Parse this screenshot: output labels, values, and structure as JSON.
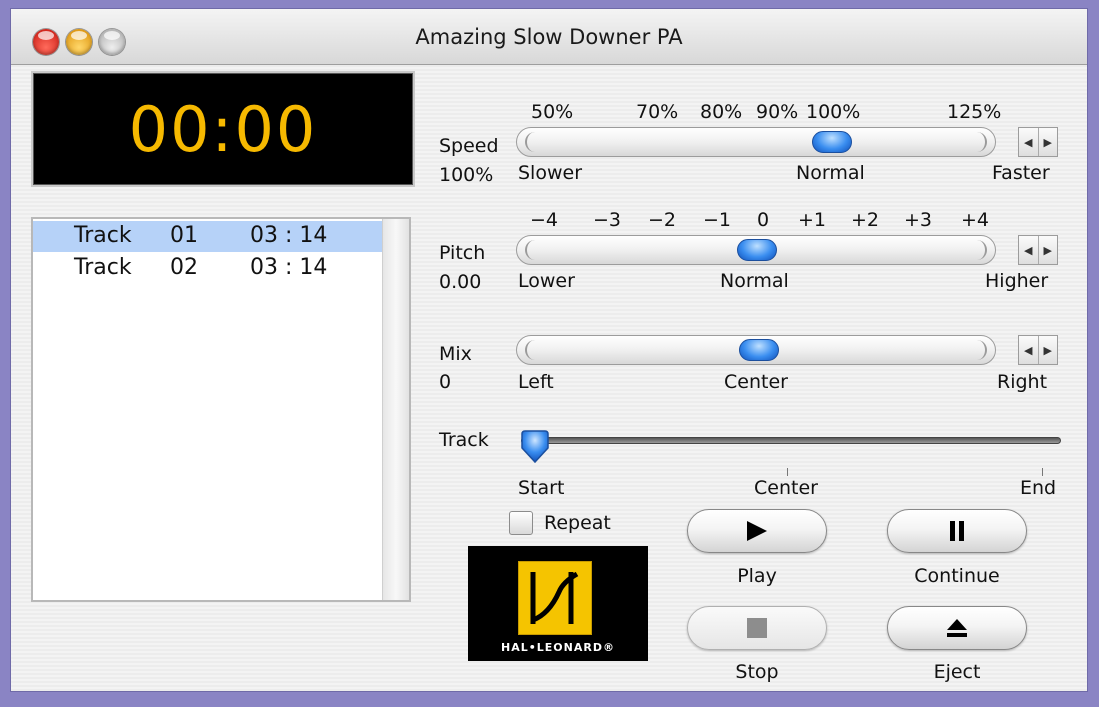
{
  "window": {
    "title": "Amazing Slow Downer PA"
  },
  "time_display": {
    "value": "00:00"
  },
  "tracks": [
    {
      "name": "Track",
      "number": "01",
      "duration": "03 : 14",
      "selected": true
    },
    {
      "name": "Track",
      "number": "02",
      "duration": "03 : 14",
      "selected": false
    }
  ],
  "speed": {
    "label": "Speed",
    "value": "100%",
    "scale": [
      "50%",
      "70%",
      "80%",
      "90%",
      "100%",
      "125%"
    ],
    "left_label": "Slower",
    "center_label": "Normal",
    "right_label": "Faster",
    "level_percent": 100
  },
  "pitch": {
    "label": "Pitch",
    "value": "0.00",
    "scale": [
      "−4",
      "−3",
      "−2",
      "−1",
      "0",
      "+1",
      "+2",
      "+3",
      "+4"
    ],
    "left_label": "Lower",
    "center_label": "Normal",
    "right_label": "Higher",
    "level": 0
  },
  "mix": {
    "label": "Mix",
    "value": "0",
    "left_label": "Left",
    "center_label": "Center",
    "right_label": "Right",
    "level": 0
  },
  "track_position": {
    "label": "Track",
    "start_label": "Start",
    "center_label": "Center",
    "end_label": "End",
    "position_fraction": 0
  },
  "repeat": {
    "label": "Repeat",
    "checked": false
  },
  "logo": {
    "brand": "HAL•LEONARD®"
  },
  "buttons": {
    "play": {
      "label": "Play",
      "icon": "play-icon"
    },
    "continue": {
      "label": "Continue",
      "icon": "pause-icon"
    },
    "stop": {
      "label": "Stop",
      "icon": "stop-icon",
      "enabled": false
    },
    "eject": {
      "label": "Eject",
      "icon": "eject-icon"
    }
  },
  "colors": {
    "desktop": "#8a84c4",
    "time_digits": "#f6b900",
    "selection": "#b6d2f8",
    "knob": "#3a8ef0",
    "logo_yellow": "#f5c400"
  }
}
